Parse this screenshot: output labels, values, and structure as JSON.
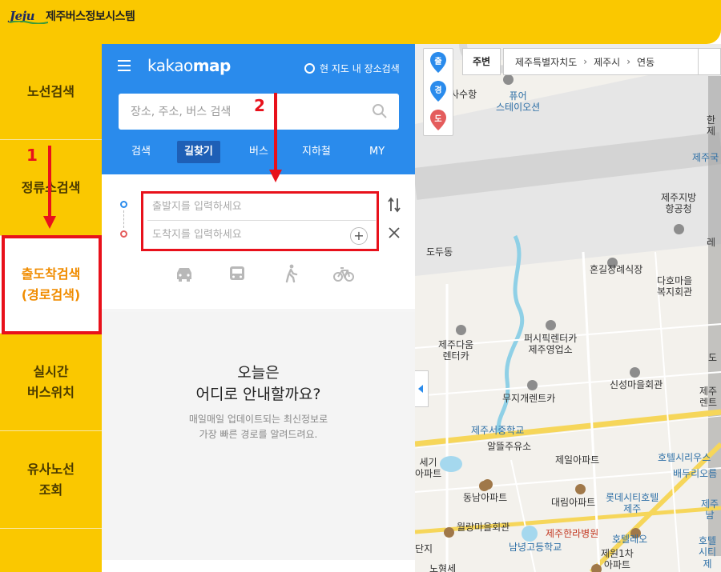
{
  "app": {
    "logo_mark": "Jeju",
    "title": "제주버스정보시스템"
  },
  "sidebar": {
    "items": [
      {
        "label": "노선검색"
      },
      {
        "label": "정류소검색"
      },
      {
        "label": "출도착검색\n(경로검색)"
      },
      {
        "label": "실시간\n버스위치"
      },
      {
        "label": "유사노선\n조회"
      }
    ]
  },
  "kakao": {
    "brand_light": "kakao",
    "brand_bold": "map",
    "radio_label": "현 지도 내 장소검색",
    "search_placeholder": "장소, 주소, 버스 검색",
    "tabs": [
      {
        "label": "검색"
      },
      {
        "label": "길찾기"
      },
      {
        "label": "버스"
      },
      {
        "label": "지하철"
      },
      {
        "label": "MY"
      }
    ],
    "route": {
      "start_placeholder": "출발지를 입력하세요",
      "end_placeholder": "도착지를 입력하세요",
      "add_label": "+"
    },
    "empty": {
      "title": "오늘은\n어디로 안내할까요?",
      "subtitle": "매일매일 업데이트되는 최신정보로\n가장 빠른 경로를 알려드려요."
    }
  },
  "annotations": {
    "step1": "1",
    "step2": "2"
  },
  "map": {
    "pins": [
      {
        "label": "출"
      },
      {
        "label": "경"
      },
      {
        "label": "도"
      }
    ],
    "nearby_button": "주변",
    "breadcrumb": [
      "제주특별자치도",
      "제주시",
      "연동"
    ],
    "labels": {
      "gisahang": "사수항",
      "pyuer": "퓨어\n스테이오션",
      "dodu": "도두동",
      "hongil": "혼길장례식장",
      "jeju_airport_main": "제주지방\n항공청",
      "jejuguk": "제주국",
      "han": "한\n제",
      "dahomaul": "다호마을\n복지회관",
      "jejudaum": "제주다움\n렌터카",
      "perfect": "퍼시픽렌터카\n제주영업소",
      "mujigae": "무지개렌트카",
      "sinseong": "신성마을회관",
      "seojung": "제주서중학교",
      "albatross": "알뜰주유소",
      "jeil": "제일아파트",
      "hotel_citrus": "호텔시리우스",
      "baesdi": "배두리오름",
      "seg": "세기\n아파트",
      "dongnam": "동남아파트",
      "daerim": "대림아파트",
      "lotte": "롯데시티호텔\n제주",
      "jejunam": "제주남",
      "wolryang": "월랑마을회관",
      "hanra": "제주한라병원",
      "hotel_rero": "호텔레오",
      "hotel_bottom": "호텔\n시티 제",
      "namnyeong": "남녕고등학교",
      "jewon": "제원1차\n아파트",
      "danji": "단지",
      "re": "레",
      "do": "도",
      "hyeon": "제주\n렌트",
      "nohyeong": "노형세"
    }
  }
}
